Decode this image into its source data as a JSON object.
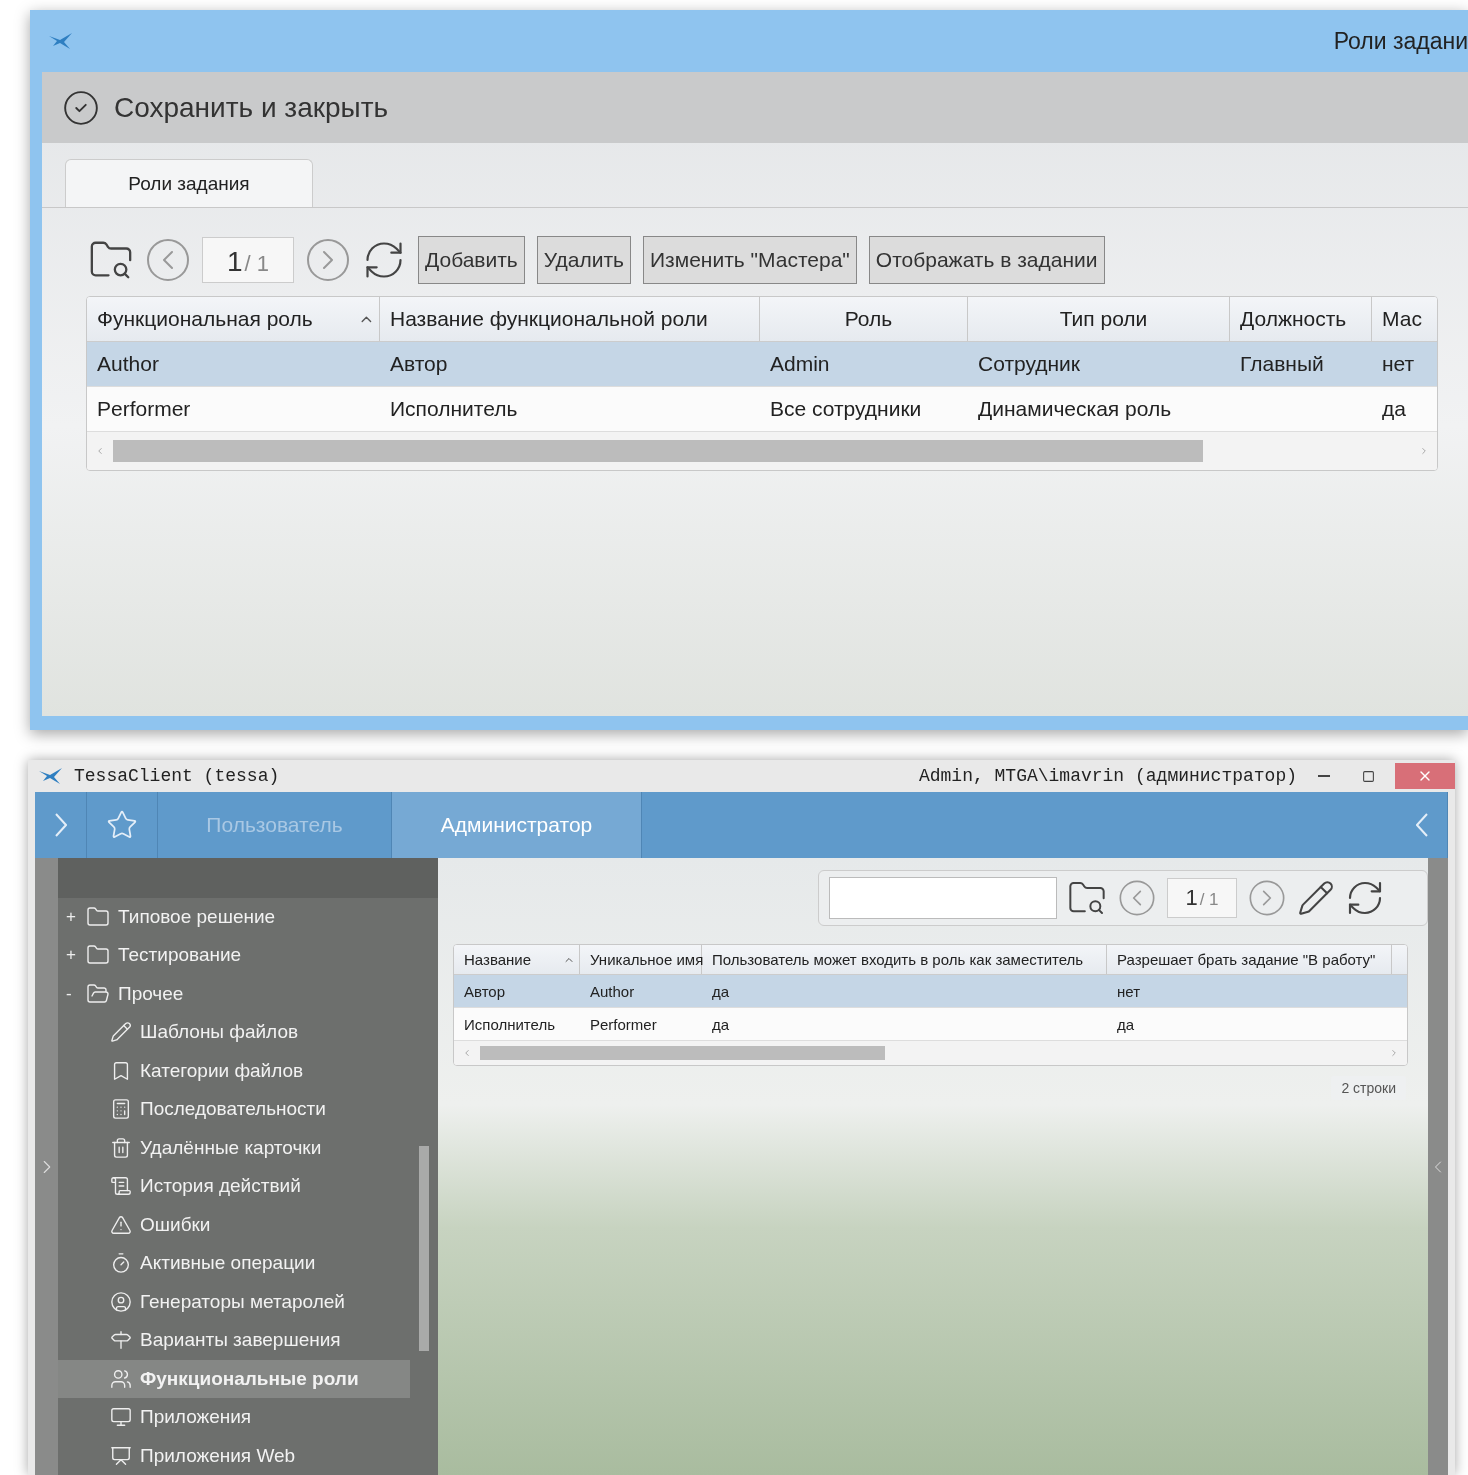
{
  "task_roles_window": {
    "title": "Роли задани",
    "save_button": "Сохранить и закрыть",
    "tabs": [
      {
        "label": "Роли задания",
        "selected": true
      }
    ],
    "pager": {
      "current": "1",
      "total": "/ 1"
    },
    "buttons": [
      "Добавить",
      "Удалить",
      "Изменить \"Мастера\"",
      "Отображать в задании"
    ],
    "table": {
      "columns": [
        {
          "label": "Функциональная роль",
          "sorted": true
        },
        {
          "label": "Название функциональной роли",
          "sorted": false
        },
        {
          "label": "Роль",
          "sorted": false
        },
        {
          "label": "Тип роли",
          "sorted": false
        },
        {
          "label": "Должность",
          "sorted": false
        },
        {
          "label": "Мас",
          "sorted": false
        }
      ],
      "rows": [
        {
          "selected": true,
          "cells": [
            "Author",
            "Автор",
            "Admin",
            "Сотрудник",
            "Главный",
            "нет"
          ]
        },
        {
          "selected": false,
          "cells": [
            "Performer",
            "Исполнитель",
            "Все сотрудники",
            "Динамическая роль",
            "",
            "да"
          ]
        }
      ]
    }
  },
  "client_window": {
    "title": "TessaClient (tessa)",
    "user": "Admin, MTGA\\imavrin (администратор)",
    "nav_tabs": [
      {
        "label": "Пользователь",
        "selected": false
      },
      {
        "label": "Администратор",
        "selected": true
      }
    ],
    "tree": [
      {
        "label": "Типовое решение",
        "toggle": "+",
        "expanded": false
      },
      {
        "label": "Тестирование",
        "toggle": "+",
        "expanded": false
      },
      {
        "label": "Прочее",
        "toggle": "-",
        "expanded": true,
        "children": [
          {
            "label": "Шаблоны файлов",
            "selected": false
          },
          {
            "label": "Категории файлов",
            "selected": false
          },
          {
            "label": "Последовательности",
            "selected": false
          },
          {
            "label": "Удалённые карточки",
            "selected": false
          },
          {
            "label": "История действий",
            "selected": false
          },
          {
            "label": "Ошибки",
            "selected": false
          },
          {
            "label": "Активные операции",
            "selected": false
          },
          {
            "label": "Генераторы метаролей",
            "selected": false
          },
          {
            "label": "Варианты завершения",
            "selected": false
          },
          {
            "label": "Функциональные роли",
            "selected": true
          },
          {
            "label": "Приложения",
            "selected": false
          },
          {
            "label": "Приложения Web",
            "selected": false
          }
        ]
      }
    ],
    "pager": {
      "current": "1",
      "total": "/ 1"
    },
    "table": {
      "columns": [
        {
          "label": "Название",
          "sorted": true
        },
        {
          "label": "Уникальное имя",
          "sorted": false
        },
        {
          "label": "Пользователь может входить в роль как заместитель",
          "sorted": false
        },
        {
          "label": "Разрешает брать задание \"В работу\"",
          "sorted": false
        }
      ],
      "rows": [
        {
          "selected": true,
          "cells": [
            "Автор",
            "Author",
            "да",
            "нет"
          ]
        },
        {
          "selected": false,
          "cells": [
            "Исполнитель",
            "Performer",
            "да",
            "да"
          ]
        }
      ]
    },
    "row_count": "2 строки"
  }
}
